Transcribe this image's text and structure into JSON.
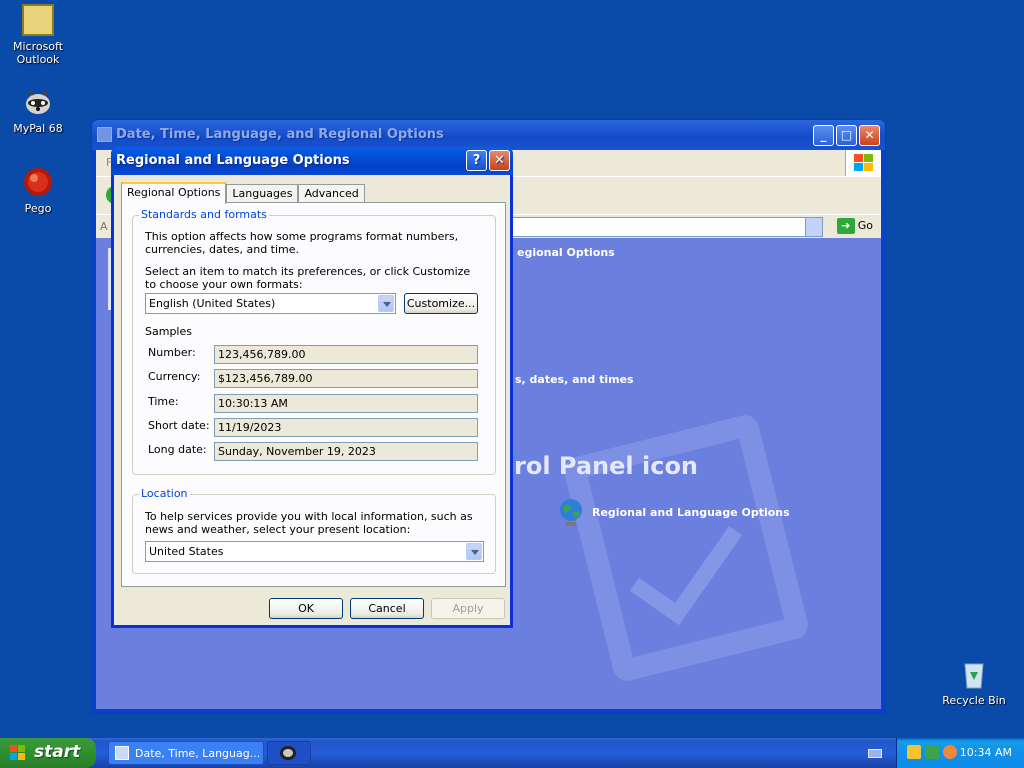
{
  "desktop": {
    "icons": [
      {
        "label": "Microsoft Outlook"
      },
      {
        "label": "MyPal 68"
      },
      {
        "label": "Pego"
      },
      {
        "label": "Recycle Bin"
      }
    ]
  },
  "control_panel": {
    "title": "Date, Time, Language, and Regional Options",
    "menu_partial": "F",
    "address_partial": "A",
    "go_label": "Go",
    "heading_regional_partial": "egional Options",
    "task_partial": "s, dates, and times",
    "pick_icon_partial": "rol Panel icon",
    "icon_link": "Regional and Language Options"
  },
  "dialog": {
    "title": "Regional and Language Options",
    "help_glyph": "?",
    "close_glyph": "✕",
    "tabs": [
      "Regional Options",
      "Languages",
      "Advanced"
    ],
    "standards": {
      "label": "Standards and formats",
      "description": "This option affects how some programs format numbers, currencies, dates, and time.",
      "select_prompt": "Select an item to match its preferences, or click Customize to choose your own formats:",
      "locale": "English (United States)",
      "customize": "Customize...",
      "samples_label": "Samples",
      "samples": [
        {
          "label": "Number:",
          "value": "123,456,789.00"
        },
        {
          "label": "Currency:",
          "value": "$123,456,789.00"
        },
        {
          "label": "Time:",
          "value": "10:30:13 AM"
        },
        {
          "label": "Short date:",
          "value": "11/19/2023"
        },
        {
          "label": "Long date:",
          "value": "Sunday, November 19, 2023"
        }
      ]
    },
    "location": {
      "label": "Location",
      "description": "To help services provide you with local information, such as news and weather, select your present location:",
      "value": "United States"
    },
    "buttons": {
      "ok": "OK",
      "cancel": "Cancel",
      "apply": "Apply"
    }
  },
  "taskbar": {
    "start": "start",
    "task1": "Date, Time, Languag...",
    "clock": "10:34 AM"
  }
}
